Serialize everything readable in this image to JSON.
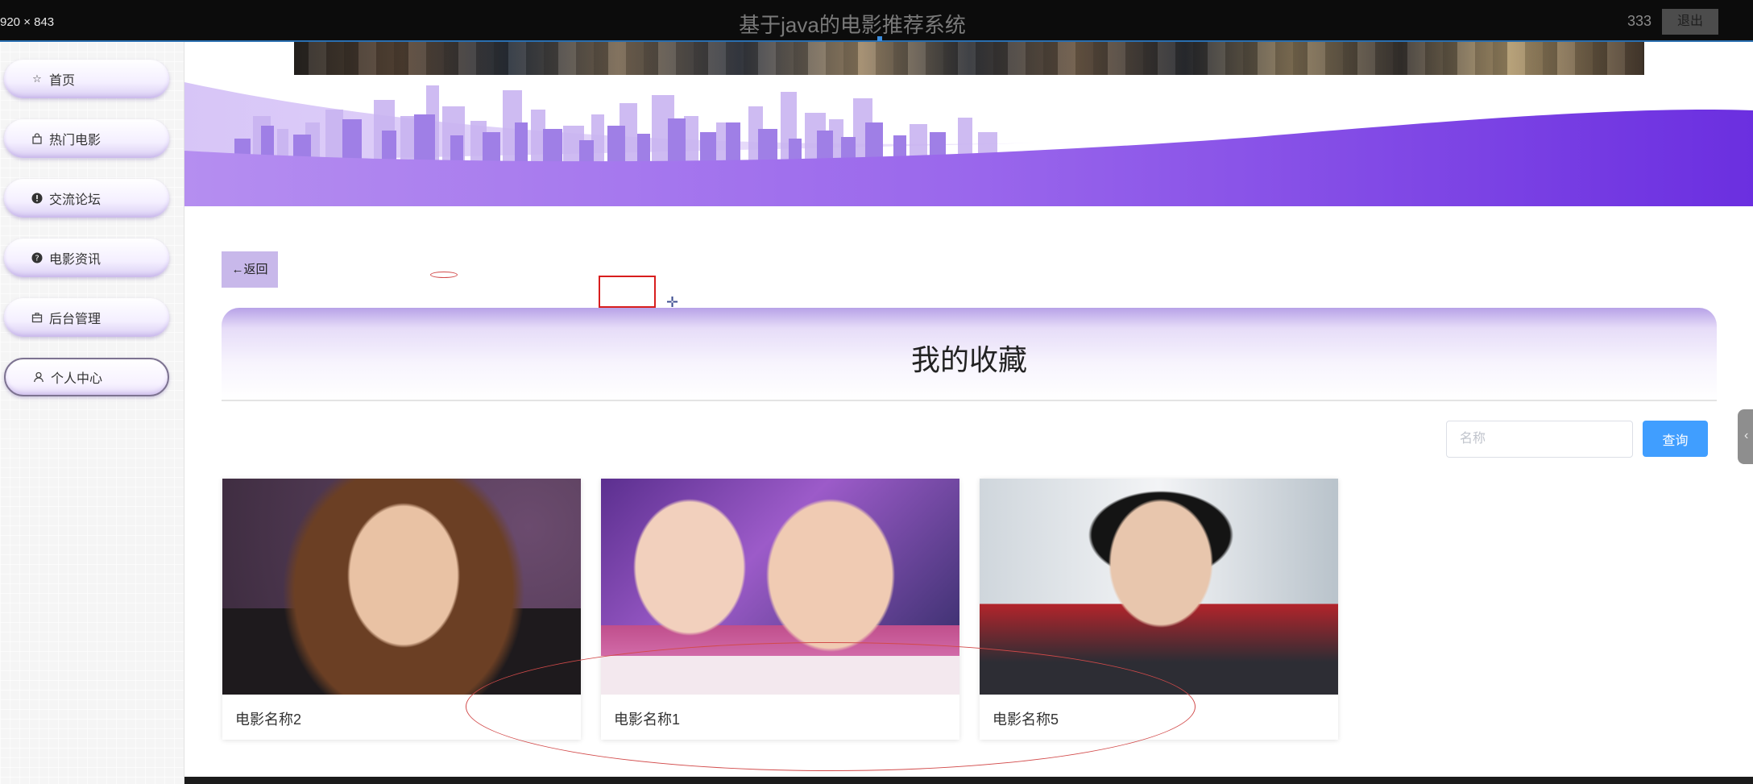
{
  "window": {
    "dimension_label": "920 × 843",
    "title": "基于java的电影推荐系统",
    "username": "333",
    "logout_label": "退出"
  },
  "sidebar": {
    "items": [
      {
        "label": "首页",
        "icon": "star-icon"
      },
      {
        "label": "热门电影",
        "icon": "bag-icon"
      },
      {
        "label": "交流论坛",
        "icon": "alert-circle-icon"
      },
      {
        "label": "电影资讯",
        "icon": "question-circle-icon"
      },
      {
        "label": "后台管理",
        "icon": "briefcase-icon"
      },
      {
        "label": "个人中心",
        "icon": "user-icon",
        "active": true
      }
    ]
  },
  "page": {
    "back_label": "←返回",
    "heading": "我的收藏",
    "search": {
      "placeholder": "名称",
      "value": ""
    },
    "search_button": "查询"
  },
  "favorites": [
    {
      "name": "电影名称2"
    },
    {
      "name": "电影名称1"
    },
    {
      "name": "电影名称5"
    }
  ],
  "colors": {
    "accent_purple": "#7b3fe4",
    "search_button": "#409eff",
    "annotation_red": "#d81e1e"
  }
}
